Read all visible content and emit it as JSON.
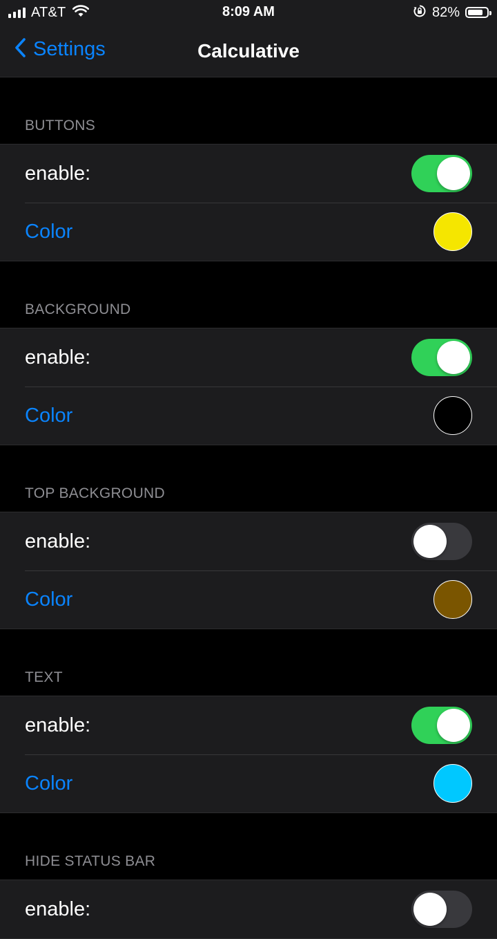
{
  "status_bar": {
    "carrier": "AT&T",
    "time": "8:09 AM",
    "battery_percent": "82%",
    "battery_level": 0.82,
    "icons": [
      "signal-icon",
      "wifi-icon",
      "orientation-lock-icon",
      "battery-icon"
    ]
  },
  "nav": {
    "back_label": "Settings",
    "title": "Calculative"
  },
  "sections": [
    {
      "header": "BUTTONS",
      "enable_label": "enable:",
      "enabled": true,
      "color_label": "Color",
      "color": "#f5e600"
    },
    {
      "header": "BACKGROUND",
      "enable_label": "enable:",
      "enabled": true,
      "color_label": "Color",
      "color": "#000000"
    },
    {
      "header": "TOP BACKGROUND",
      "enable_label": "enable:",
      "enabled": false,
      "color_label": "Color",
      "color": "#7a5500"
    },
    {
      "header": "TEXT",
      "enable_label": "enable:",
      "enabled": true,
      "color_label": "Color",
      "color": "#00c8ff"
    },
    {
      "header": "HIDE STATUS BAR",
      "enable_label": "enable:",
      "enabled": false
    }
  ],
  "colors": {
    "accent": "#0a84ff",
    "toggle_on": "#30d158",
    "toggle_off": "#39393d",
    "cell_background": "#1c1c1e",
    "page_background": "#000000",
    "header_text": "#8e8e93"
  }
}
